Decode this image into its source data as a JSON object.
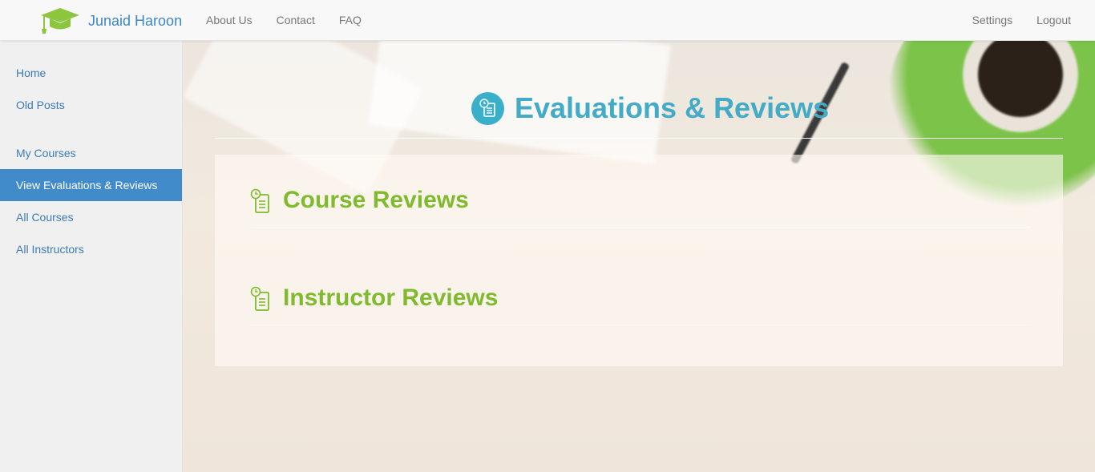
{
  "navbar": {
    "brand": "Junaid Haroon",
    "logo_icon": "graduation-cap-icon",
    "links_left": [
      "About Us",
      "Contact",
      "FAQ"
    ],
    "links_right": [
      "Settings",
      "Logout"
    ],
    "brand_color": "#3c88c3"
  },
  "sidebar": {
    "items": [
      {
        "label": "Home"
      },
      {
        "label": "Old Posts"
      },
      {
        "label": "My Courses"
      },
      {
        "label": "View Evaluations & Reviews",
        "active": true
      },
      {
        "label": "All Courses"
      },
      {
        "label": "All Instructors"
      }
    ],
    "active_color": "#428bca"
  },
  "main": {
    "title": "Evaluations & Reviews",
    "title_icon": "clipboard-clock-icon",
    "title_color": "#43abc6",
    "sections": [
      {
        "title": "Course Reviews",
        "icon": "clipboard-clock-icon"
      },
      {
        "title": "Instructor Reviews",
        "icon": "clipboard-clock-icon"
      }
    ],
    "section_color": "#7fba2f"
  }
}
